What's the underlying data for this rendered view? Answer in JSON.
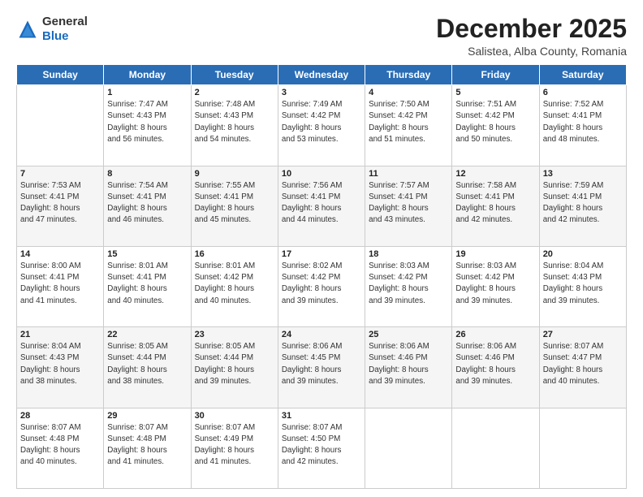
{
  "logo": {
    "general": "General",
    "blue": "Blue"
  },
  "header": {
    "month_title": "December 2025",
    "subtitle": "Salistea, Alba County, Romania"
  },
  "days_of_week": [
    "Sunday",
    "Monday",
    "Tuesday",
    "Wednesday",
    "Thursday",
    "Friday",
    "Saturday"
  ],
  "weeks": [
    [
      {
        "day": null,
        "info": null
      },
      {
        "day": "1",
        "info": "Sunrise: 7:47 AM\nSunset: 4:43 PM\nDaylight: 8 hours\nand 56 minutes."
      },
      {
        "day": "2",
        "info": "Sunrise: 7:48 AM\nSunset: 4:43 PM\nDaylight: 8 hours\nand 54 minutes."
      },
      {
        "day": "3",
        "info": "Sunrise: 7:49 AM\nSunset: 4:42 PM\nDaylight: 8 hours\nand 53 minutes."
      },
      {
        "day": "4",
        "info": "Sunrise: 7:50 AM\nSunset: 4:42 PM\nDaylight: 8 hours\nand 51 minutes."
      },
      {
        "day": "5",
        "info": "Sunrise: 7:51 AM\nSunset: 4:42 PM\nDaylight: 8 hours\nand 50 minutes."
      },
      {
        "day": "6",
        "info": "Sunrise: 7:52 AM\nSunset: 4:41 PM\nDaylight: 8 hours\nand 48 minutes."
      }
    ],
    [
      {
        "day": "7",
        "info": "Sunrise: 7:53 AM\nSunset: 4:41 PM\nDaylight: 8 hours\nand 47 minutes."
      },
      {
        "day": "8",
        "info": "Sunrise: 7:54 AM\nSunset: 4:41 PM\nDaylight: 8 hours\nand 46 minutes."
      },
      {
        "day": "9",
        "info": "Sunrise: 7:55 AM\nSunset: 4:41 PM\nDaylight: 8 hours\nand 45 minutes."
      },
      {
        "day": "10",
        "info": "Sunrise: 7:56 AM\nSunset: 4:41 PM\nDaylight: 8 hours\nand 44 minutes."
      },
      {
        "day": "11",
        "info": "Sunrise: 7:57 AM\nSunset: 4:41 PM\nDaylight: 8 hours\nand 43 minutes."
      },
      {
        "day": "12",
        "info": "Sunrise: 7:58 AM\nSunset: 4:41 PM\nDaylight: 8 hours\nand 42 minutes."
      },
      {
        "day": "13",
        "info": "Sunrise: 7:59 AM\nSunset: 4:41 PM\nDaylight: 8 hours\nand 42 minutes."
      }
    ],
    [
      {
        "day": "14",
        "info": "Sunrise: 8:00 AM\nSunset: 4:41 PM\nDaylight: 8 hours\nand 41 minutes."
      },
      {
        "day": "15",
        "info": "Sunrise: 8:01 AM\nSunset: 4:41 PM\nDaylight: 8 hours\nand 40 minutes."
      },
      {
        "day": "16",
        "info": "Sunrise: 8:01 AM\nSunset: 4:42 PM\nDaylight: 8 hours\nand 40 minutes."
      },
      {
        "day": "17",
        "info": "Sunrise: 8:02 AM\nSunset: 4:42 PM\nDaylight: 8 hours\nand 39 minutes."
      },
      {
        "day": "18",
        "info": "Sunrise: 8:03 AM\nSunset: 4:42 PM\nDaylight: 8 hours\nand 39 minutes."
      },
      {
        "day": "19",
        "info": "Sunrise: 8:03 AM\nSunset: 4:42 PM\nDaylight: 8 hours\nand 39 minutes."
      },
      {
        "day": "20",
        "info": "Sunrise: 8:04 AM\nSunset: 4:43 PM\nDaylight: 8 hours\nand 39 minutes."
      }
    ],
    [
      {
        "day": "21",
        "info": "Sunrise: 8:04 AM\nSunset: 4:43 PM\nDaylight: 8 hours\nand 38 minutes."
      },
      {
        "day": "22",
        "info": "Sunrise: 8:05 AM\nSunset: 4:44 PM\nDaylight: 8 hours\nand 38 minutes."
      },
      {
        "day": "23",
        "info": "Sunrise: 8:05 AM\nSunset: 4:44 PM\nDaylight: 8 hours\nand 39 minutes."
      },
      {
        "day": "24",
        "info": "Sunrise: 8:06 AM\nSunset: 4:45 PM\nDaylight: 8 hours\nand 39 minutes."
      },
      {
        "day": "25",
        "info": "Sunrise: 8:06 AM\nSunset: 4:46 PM\nDaylight: 8 hours\nand 39 minutes."
      },
      {
        "day": "26",
        "info": "Sunrise: 8:06 AM\nSunset: 4:46 PM\nDaylight: 8 hours\nand 39 minutes."
      },
      {
        "day": "27",
        "info": "Sunrise: 8:07 AM\nSunset: 4:47 PM\nDaylight: 8 hours\nand 40 minutes."
      }
    ],
    [
      {
        "day": "28",
        "info": "Sunrise: 8:07 AM\nSunset: 4:48 PM\nDaylight: 8 hours\nand 40 minutes."
      },
      {
        "day": "29",
        "info": "Sunrise: 8:07 AM\nSunset: 4:48 PM\nDaylight: 8 hours\nand 41 minutes."
      },
      {
        "day": "30",
        "info": "Sunrise: 8:07 AM\nSunset: 4:49 PM\nDaylight: 8 hours\nand 41 minutes."
      },
      {
        "day": "31",
        "info": "Sunrise: 8:07 AM\nSunset: 4:50 PM\nDaylight: 8 hours\nand 42 minutes."
      },
      {
        "day": null,
        "info": null
      },
      {
        "day": null,
        "info": null
      },
      {
        "day": null,
        "info": null
      }
    ]
  ]
}
